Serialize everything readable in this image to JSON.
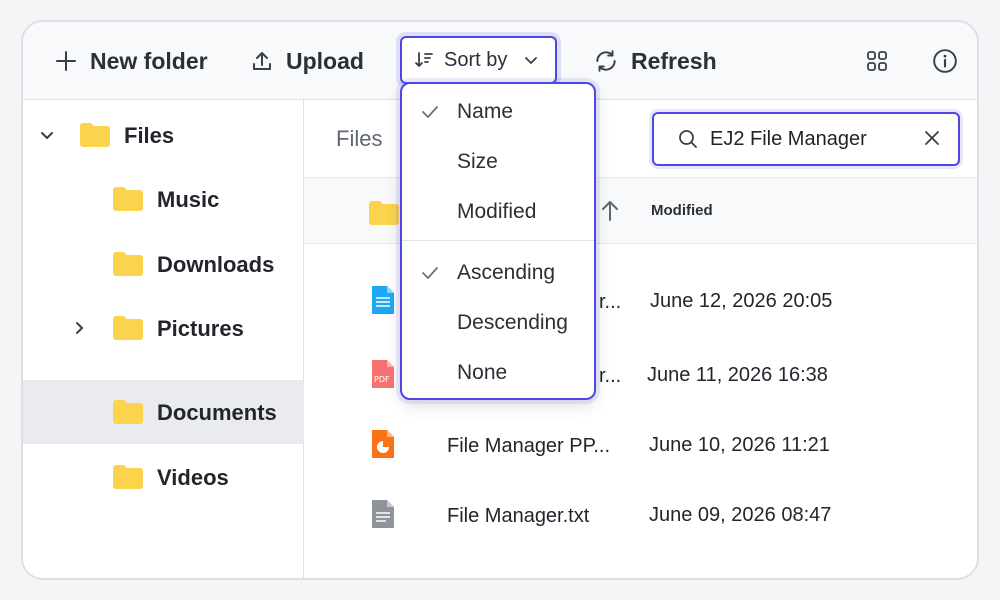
{
  "toolbar": {
    "new_folder": "New folder",
    "upload": "Upload",
    "sort_by": "Sort by",
    "refresh": "Refresh"
  },
  "sidebar": {
    "root": "Files",
    "items": [
      "Music",
      "Downloads",
      "Pictures",
      "Documents",
      "Videos"
    ],
    "selected": "Documents"
  },
  "address": {
    "crumb": "Files"
  },
  "search": {
    "value": "EJ2 File Manager"
  },
  "grid": {
    "col_modified": "Modified",
    "rows": [
      {
        "name": "File Manager.docx",
        "name_shown": "r...",
        "modified": "June 12, 2026 20:05",
        "icon": "doc-icon"
      },
      {
        "name": "File Manager.pdf",
        "name_shown": "r...",
        "modified": "June 11, 2026 16:38",
        "icon": "pdf-icon"
      },
      {
        "name": "File Manager PP...",
        "name_shown": "File Manager PP...",
        "modified": "June 10, 2026 11:21",
        "icon": "ppt-icon"
      },
      {
        "name": "File Manager.txt",
        "name_shown": "File Manager.txt",
        "modified": "June 09, 2026 08:47",
        "icon": "txt-icon"
      }
    ]
  },
  "sort_menu": {
    "fields": [
      {
        "label": "Name",
        "checked": true
      },
      {
        "label": "Size",
        "checked": false
      },
      {
        "label": "Modified",
        "checked": false
      }
    ],
    "orders": [
      {
        "label": "Ascending",
        "checked": true
      },
      {
        "label": "Descending",
        "checked": false
      },
      {
        "label": "None",
        "checked": false
      }
    ]
  },
  "colors": {
    "accent": "#4f46e5",
    "folder": "#fcd34d",
    "selected_bg": "#e9ebef"
  }
}
